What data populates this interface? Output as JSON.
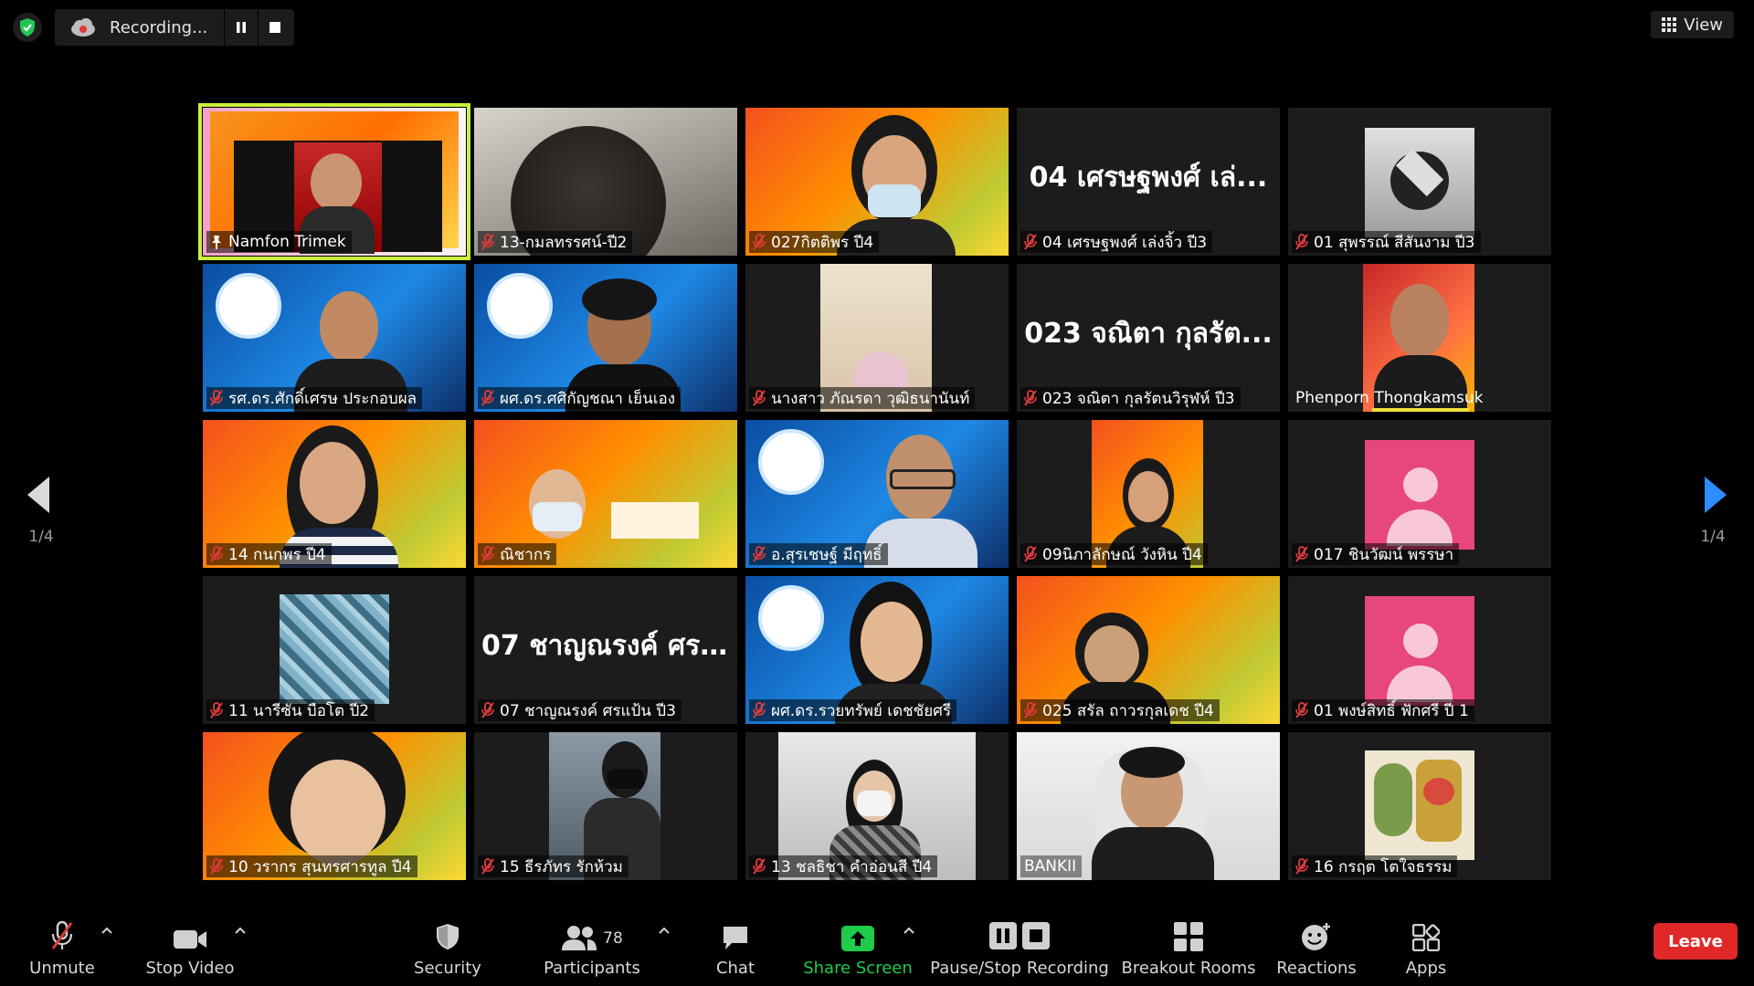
{
  "top": {
    "recording_label": "Recording...",
    "view_label": "View"
  },
  "pagination": {
    "left": "1/4",
    "right": "1/4"
  },
  "tiles": [
    {
      "name": "Namfon Trimek",
      "muted": false,
      "pinned": true
    },
    {
      "name": "13-กมลทรรศน์-ปี2",
      "muted": true
    },
    {
      "name": "027กิตติพร ปี4",
      "muted": true
    },
    {
      "name": "04 เศรษฐพงศ์ เล่งจิ้ว ปี3",
      "big": "04 เศรษฐพงศ์ เล่...",
      "muted": true
    },
    {
      "name": "01 สุพรรณ์ สีสันงาม ปี3",
      "muted": true
    },
    {
      "name": "รศ.ดร.ศักดิ์เศรษ ประกอบผล",
      "muted": true
    },
    {
      "name": "ผศ.ดร.ศศิกัญชณา เย็นเอง",
      "muted": true
    },
    {
      "name": "นางสาว ภัณรดา วุฒิธนานันท์",
      "muted": true
    },
    {
      "name": "023 จณิตา กุลรัตนวิรุฬห์ ปี3",
      "big": "023 จณิตา กุลรัต...",
      "muted": true
    },
    {
      "name": "Phenporn Thongkamsuk",
      "muted": false
    },
    {
      "name": "14 กนกพร ปี4",
      "muted": true
    },
    {
      "name": "ณิชากร",
      "muted": true
    },
    {
      "name": "อ.สุรเชษฐ์ มีฤทธิ์",
      "muted": true
    },
    {
      "name": "09นิภาลักษณ์ วังหิน ปี4",
      "muted": true
    },
    {
      "name": "017 ชินวัฒน์ พรรษา",
      "muted": true
    },
    {
      "name": "11 นารีซัน บือโต ปี2",
      "muted": true
    },
    {
      "name": "07 ชาญณรงค์ ศรแป้น ปี3",
      "big": "07 ชาญณรงค์ ศร...",
      "muted": true
    },
    {
      "name": "ผศ.ดร.รวยทรัพย์ เดชชัยศรี",
      "muted": true
    },
    {
      "name": "025 สรัล ถาวรกุลเดช ปี4",
      "muted": true
    },
    {
      "name": "01 พงษ์สิทธิ์ ฟักศรี ปี 1",
      "muted": true
    },
    {
      "name": "10 วรากร สุนทรศารทูล ปี4",
      "muted": true
    },
    {
      "name": "15 ธีรภัทร รักห้วม",
      "muted": true
    },
    {
      "name": "13 ชลธิชา คำอ่อนสี ปี4",
      "muted": true
    },
    {
      "name": "BANKII",
      "muted": false
    },
    {
      "name": "16 กรฤต โตใจธรรม",
      "muted": true
    }
  ],
  "toolbar": {
    "unmute": "Unmute",
    "stop_video": "Stop Video",
    "security": "Security",
    "participants": "Participants",
    "participants_count": "78",
    "chat": "Chat",
    "share_screen": "Share Screen",
    "pause_stop_recording": "Pause/Stop Recording",
    "breakout_rooms": "Breakout Rooms",
    "reactions": "Reactions",
    "apps": "Apps",
    "leave": "Leave"
  },
  "colors": {
    "active_speaker_border": "#c8f03c",
    "leave_button": "#e02828",
    "share_screen_green": "#1ecb4a",
    "muted_red": "#e03c3c"
  }
}
